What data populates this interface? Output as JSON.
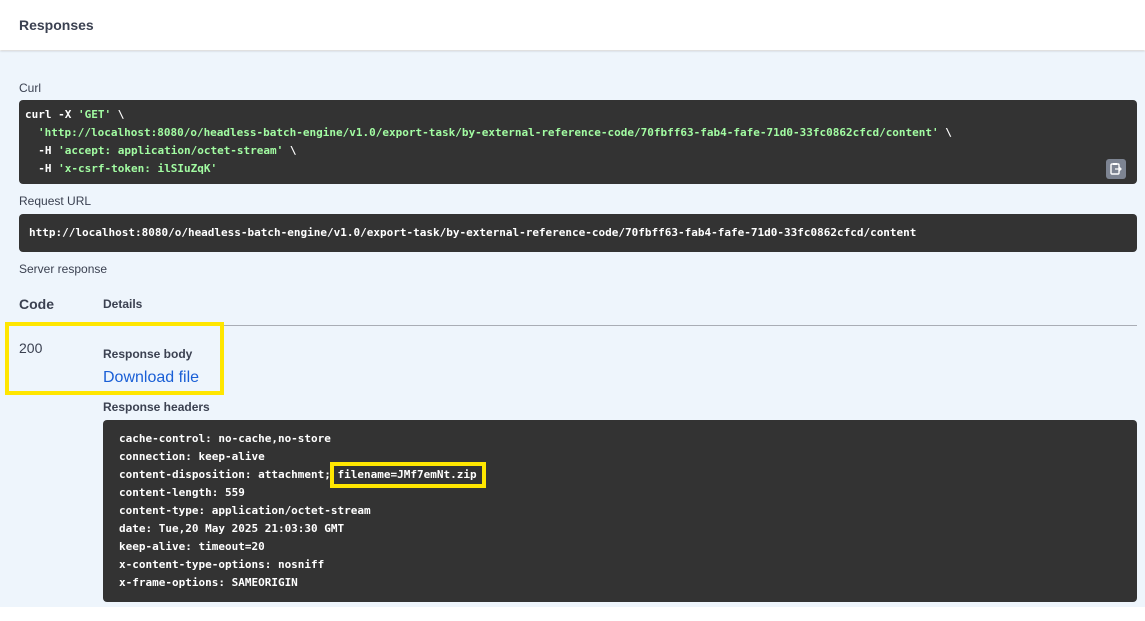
{
  "section": {
    "title": "Responses"
  },
  "curl": {
    "label": "Curl",
    "line1_cmd": "curl -X ",
    "line1_method": "'GET'",
    "line1_cont": " \\",
    "line2_url": "'http://localhost:8080/o/headless-batch-engine/v1.0/export-task/by-external-reference-code/70fbff63-fab4-fafe-71d0-33fc0862cfcd/content'",
    "line2_cont": " \\",
    "line3_flag": "  -H ",
    "line3_val": "'accept: application/octet-stream'",
    "line3_cont": " \\",
    "line4_flag": "  -H ",
    "line4_val": "'x-csrf-token: ilSIuZqK'"
  },
  "request_url": {
    "label": "Request URL",
    "value": "http://localhost:8080/o/headless-batch-engine/v1.0/export-task/by-external-reference-code/70fbff63-fab4-fafe-71d0-33fc0862cfcd/content"
  },
  "server_response": {
    "label": "Server response",
    "col_code": "Code",
    "col_details": "Details",
    "status_code": "200",
    "response_body_label": "Response body",
    "download_link": "Download file",
    "response_headers_label": "Response headers",
    "headers": [
      "cache-control: no-cache,no-store",
      "connection: keep-alive",
      "content-disposition: attachment;",
      "content-length: 559",
      "content-type: application/octet-stream",
      "date: Tue,20 May 2025 21:03:30 GMT",
      "keep-alive: timeout=20",
      "x-content-type-options: nosniff",
      "x-frame-options: SAMEORIGIN"
    ],
    "filename_part": "filename=JMf7emNt.zip"
  },
  "colors": {
    "highlight": "#ffe600",
    "code_bg": "#333333",
    "string_green": "#a2fca2",
    "link_blue": "#1a5fd6"
  },
  "icons": {
    "copy": "clipboard-copy-icon"
  }
}
